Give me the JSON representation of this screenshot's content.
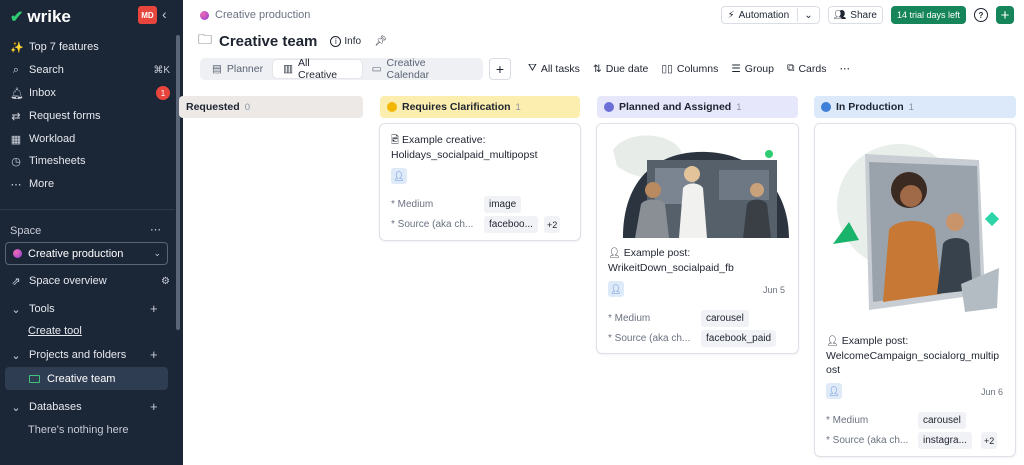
{
  "sidebar": {
    "logo": "wrike",
    "avatar_initials": "MD",
    "top_items": [
      {
        "label": "Top 7 features",
        "icon": "sparkle-icon"
      },
      {
        "label": "Search",
        "icon": "search-icon",
        "shortcut": "⌘K"
      },
      {
        "label": "Inbox",
        "icon": "bell-icon",
        "badge": "1"
      },
      {
        "label": "Request forms",
        "icon": "form-icon"
      },
      {
        "label": "Workload",
        "icon": "workload-icon"
      },
      {
        "label": "Timesheets",
        "icon": "clock-icon"
      },
      {
        "label": "More",
        "icon": "more-icon"
      }
    ],
    "space_label": "Space",
    "space_selected": "Creative production",
    "space_overview": "Space overview",
    "tools_label": "Tools",
    "create_tool": "Create tool",
    "projects_label": "Projects and folders",
    "active_folder": "Creative team",
    "databases_label": "Databases",
    "databases_empty": "There's nothing here"
  },
  "header": {
    "breadcrumb": "Creative production",
    "title": "Creative team",
    "info_label": "Info",
    "automation_label": "Automation",
    "share_label": "Share",
    "trial_label": "14 trial days left"
  },
  "views": [
    {
      "label": "Planner",
      "active": false
    },
    {
      "label": "All Creative",
      "active": true
    },
    {
      "label": "Creative Calendar",
      "active": false
    }
  ],
  "toolbar": {
    "all_tasks": "All tasks",
    "due_date": "Due date",
    "columns": "Columns",
    "group": "Group",
    "cards": "Cards"
  },
  "board": {
    "columns": [
      {
        "label": "Requested",
        "count": "0",
        "color": "#ece9e6",
        "dot": ""
      },
      {
        "label": "Requires Clarification",
        "count": "1",
        "color": "#fbeeae",
        "dot": "#f2b705"
      },
      {
        "label": "Planned and Assigned",
        "count": "1",
        "color": "#e6e7fa",
        "dot": "#6b6fd6"
      },
      {
        "label": "In Production",
        "count": "1",
        "color": "#dbe9fb",
        "dot": "#3d7fd9"
      }
    ],
    "cards": [
      {
        "title_line1": "Example creative:",
        "title_line2": "Holidays_socialpaid_multipopst",
        "date": "",
        "medium_label": "* Medium",
        "medium_value": "image",
        "source_label": "* Source (aka ch...",
        "source_value": "faceboo...",
        "extra": "+2"
      },
      {
        "title_line1": "Example post:",
        "title_line2": "WrikeitDown_socialpaid_fb",
        "date": "Jun 5",
        "medium_label": "* Medium",
        "medium_value": "carousel",
        "source_label": "* Source (aka ch...",
        "source_value": "facebook_paid",
        "extra": ""
      },
      {
        "title_line1": "Example post:",
        "title_line2": "WelcomeCampaign_socialorg_multip",
        "title_line3": "ost",
        "date": "Jun 6",
        "medium_label": "* Medium",
        "medium_value": "carousel",
        "source_label": "* Source (aka ch...",
        "source_value": "instagra...",
        "extra": "+2"
      }
    ]
  }
}
